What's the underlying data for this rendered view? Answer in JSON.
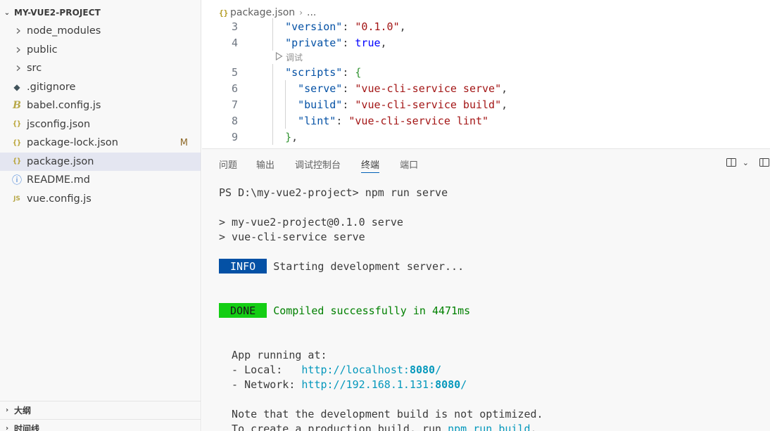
{
  "explorer": {
    "title": "MY-VUE2-PROJECT",
    "items": [
      {
        "label": "node_modules",
        "type": "folder",
        "icon": "chevron-right-icon"
      },
      {
        "label": "public",
        "type": "folder",
        "icon": "chevron-right-icon"
      },
      {
        "label": "src",
        "type": "folder",
        "icon": "chevron-right-icon"
      },
      {
        "label": ".gitignore",
        "type": "file",
        "icon": "git-icon",
        "glyph": "◆"
      },
      {
        "label": "babel.config.js",
        "type": "file",
        "icon": "babel-icon",
        "glyph": "B"
      },
      {
        "label": "jsconfig.json",
        "type": "file",
        "icon": "json-icon",
        "glyph": "{}"
      },
      {
        "label": "package-lock.json",
        "type": "file",
        "icon": "json-icon",
        "glyph": "{}",
        "badge": "M"
      },
      {
        "label": "package.json",
        "type": "file",
        "icon": "json-icon",
        "glyph": "{}",
        "selected": true
      },
      {
        "label": "README.md",
        "type": "file",
        "icon": "info-icon",
        "glyph": "ⓘ"
      },
      {
        "label": "vue.config.js",
        "type": "file",
        "icon": "js-icon",
        "glyph": "JS"
      }
    ],
    "outline_label": "大纲",
    "timeline_label": "时间线"
  },
  "editor": {
    "breadcrumb": {
      "file": "package.json",
      "more": "..."
    },
    "codelens": "调试",
    "lines": [
      {
        "n": "3",
        "indent": 1,
        "key": "\"version\"",
        "value": "\"0.1.0\"",
        "vtype": "str",
        "tail": ","
      },
      {
        "n": "4",
        "indent": 1,
        "key": "\"private\"",
        "value": "true",
        "vtype": "bool",
        "tail": ","
      },
      {
        "n": "5",
        "indent": 1,
        "key": "\"scripts\"",
        "value": "{",
        "vtype": "brace",
        "tail": "",
        "codelens_before": true
      },
      {
        "n": "6",
        "indent": 2,
        "key": "\"serve\"",
        "value": "\"vue-cli-service serve\"",
        "vtype": "str",
        "tail": ","
      },
      {
        "n": "7",
        "indent": 2,
        "key": "\"build\"",
        "value": "\"vue-cli-service build\"",
        "vtype": "str",
        "tail": ","
      },
      {
        "n": "8",
        "indent": 2,
        "key": "\"lint\"",
        "value": "\"vue-cli-service lint\"",
        "vtype": "str",
        "tail": ""
      },
      {
        "n": "9",
        "indent": 1,
        "key": "",
        "value": "}",
        "vtype": "brace",
        "tail": ","
      }
    ]
  },
  "panel": {
    "tabs": [
      "问题",
      "输出",
      "调试控制台",
      "终端",
      "端口"
    ],
    "active_tab": "终端",
    "terminal": {
      "prompt": "PS D:\\my-vue2-project> ",
      "command": "npm run serve",
      "script_line1": "> my-vue2-project@0.1.0 serve",
      "script_line2": "> vue-cli-service serve",
      "info_tag": " INFO ",
      "info_text": "Starting development server...",
      "done_tag": " DONE ",
      "done_text": "Compiled successfully in 4471ms",
      "app_running": "  App running at:",
      "local_label": "  - Local:   ",
      "local_url_prefix": "http://localhost:",
      "local_port": "8080",
      "local_url_suffix": "/",
      "network_label": "  - Network: ",
      "network_url_prefix": "http://192.168.1.131:",
      "network_port": "8080",
      "network_url_suffix": "/",
      "note": "  Note that the development build is not optimized.",
      "prod_prefix": "  To create a production build, run ",
      "prod_cmd": "npm run build",
      "prod_suffix": "."
    }
  },
  "colors": {
    "info_bg": "#0451a5",
    "done_bg": "#14ce14",
    "json_key": "#0451a5",
    "json_string": "#a31515",
    "accent": "#005fb8"
  }
}
